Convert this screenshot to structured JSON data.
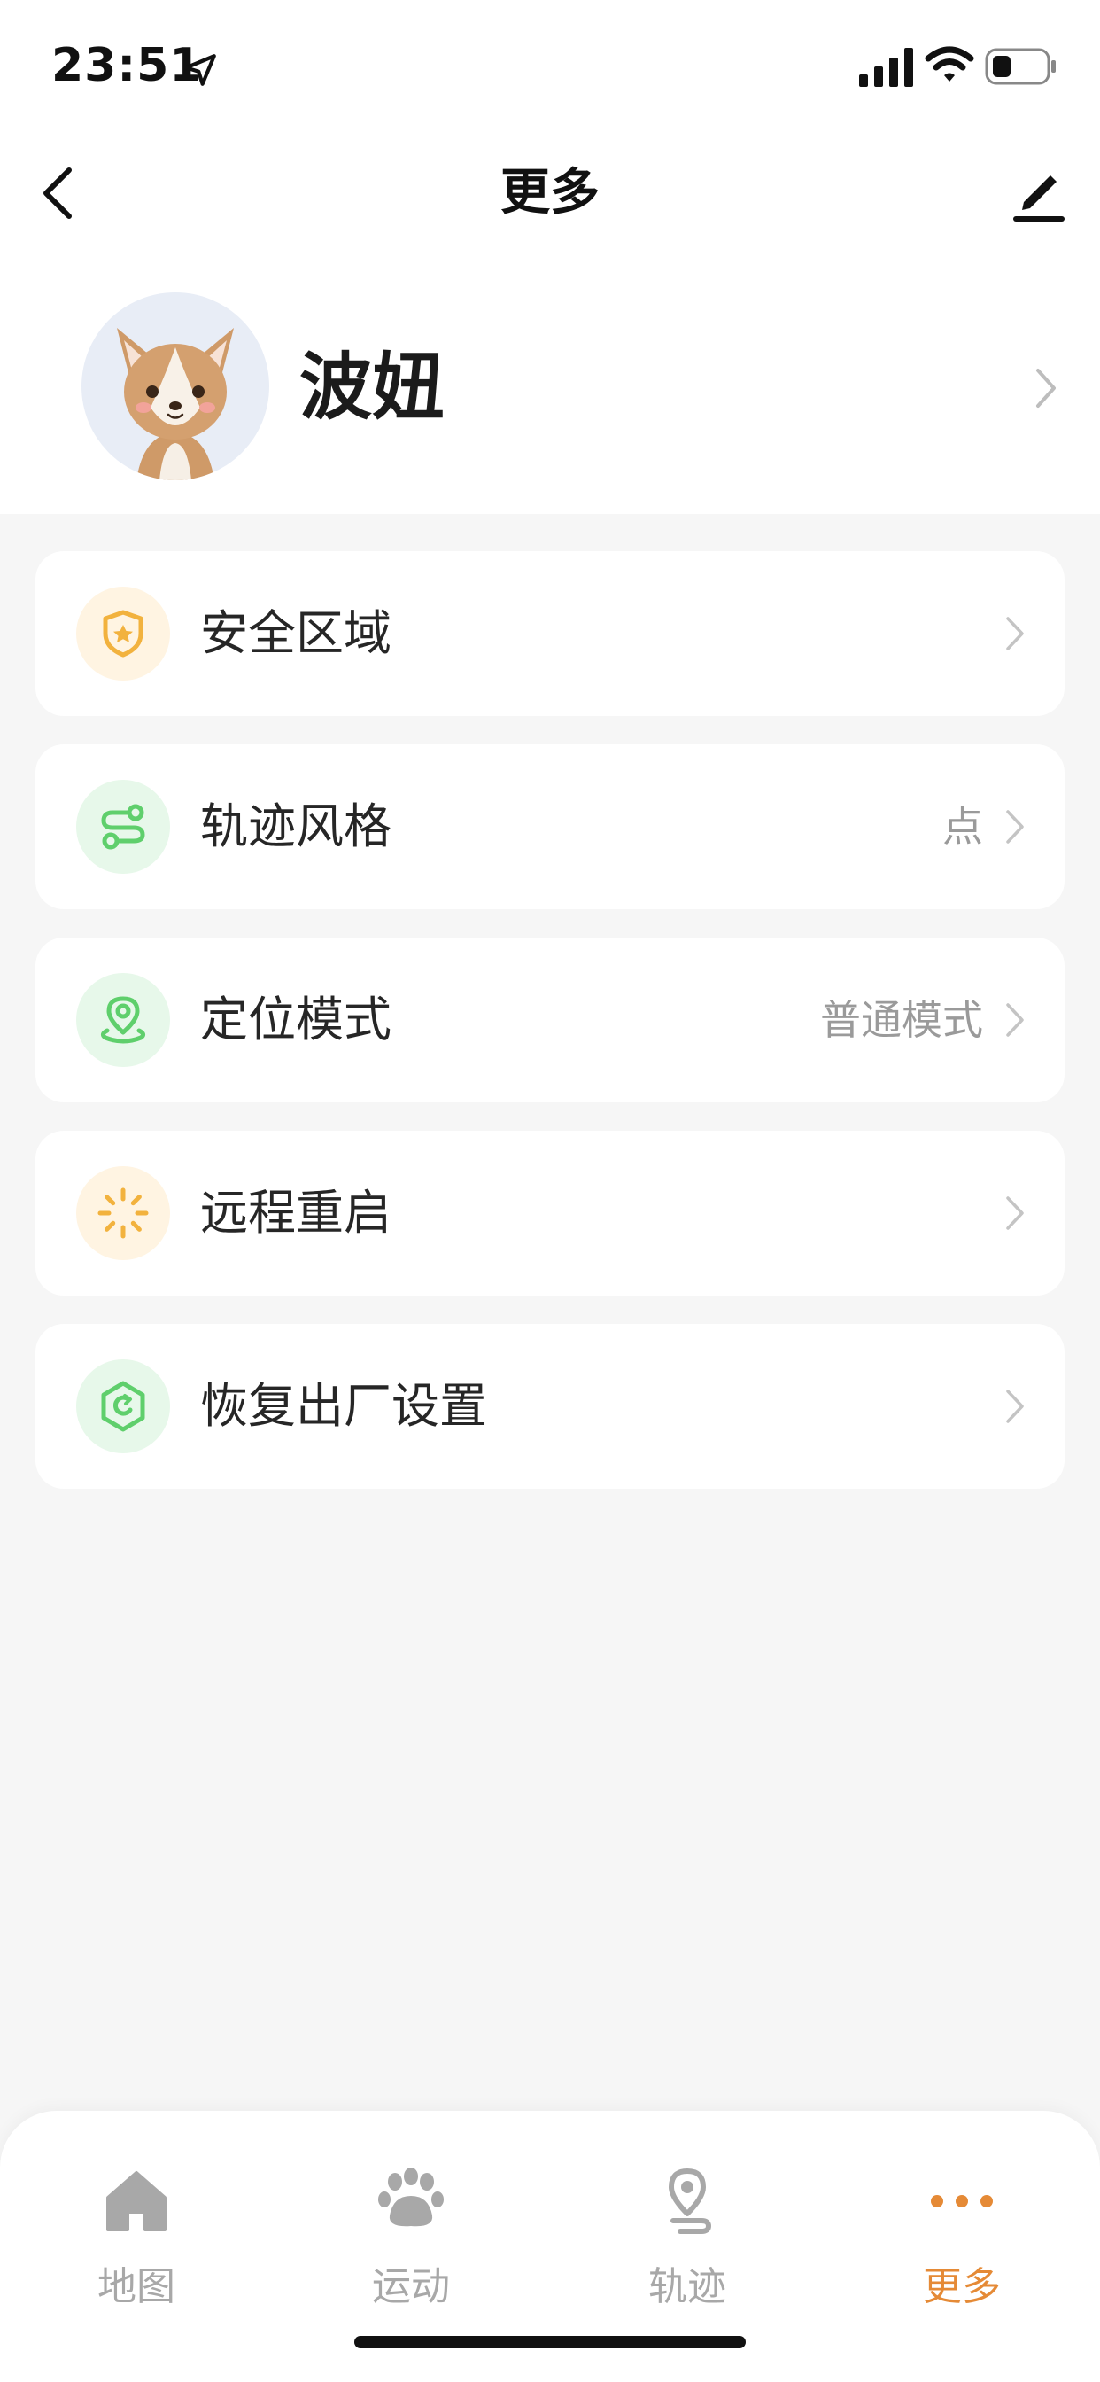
{
  "status_bar": {
    "time": "23:51"
  },
  "nav": {
    "title": "更多"
  },
  "profile": {
    "name": "波妞"
  },
  "menu": [
    {
      "label": "安全区域",
      "value": "",
      "icon": "shield-star-icon",
      "tone": "orange"
    },
    {
      "label": "轨迹风格",
      "value": "点",
      "icon": "route-icon",
      "tone": "green"
    },
    {
      "label": "定位模式",
      "value": "普通模式",
      "icon": "location-pin-icon",
      "tone": "green"
    },
    {
      "label": "远程重启",
      "value": "",
      "icon": "loading-spinner-icon",
      "tone": "orange"
    },
    {
      "label": "恢复出厂设置",
      "value": "",
      "icon": "reset-hexagon-icon",
      "tone": "green"
    }
  ],
  "tabs": [
    {
      "label": "地图",
      "icon": "home-icon",
      "active": false
    },
    {
      "label": "运动",
      "icon": "paw-icon",
      "active": false
    },
    {
      "label": "轨迹",
      "icon": "track-pin-icon",
      "active": false
    },
    {
      "label": "更多",
      "icon": "more-dots-icon",
      "active": true
    }
  ],
  "colors": {
    "accent": "#e58a36",
    "green_icon": "#5fcf6c",
    "orange_icon": "#f2b23e",
    "tab_inactive": "#a8a8a8",
    "background": "#f6f6f6"
  }
}
